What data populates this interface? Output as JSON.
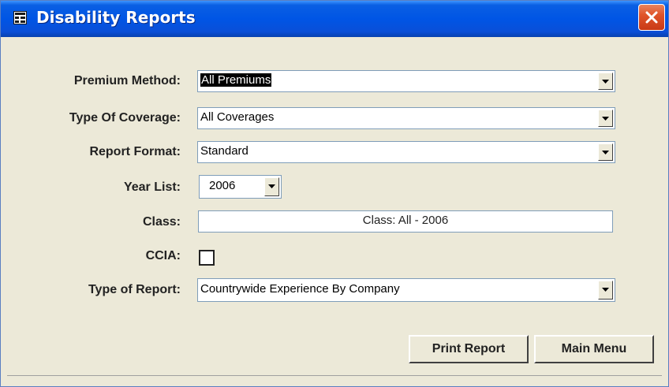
{
  "window": {
    "title": "Disability Reports",
    "icon": "form-icon",
    "close_icon": "close-icon"
  },
  "form": {
    "premium_method": {
      "label": "Premium Method:",
      "value": "All Premiums"
    },
    "type_of_coverage": {
      "label": "Type Of Coverage:",
      "value": "All Coverages"
    },
    "report_format": {
      "label": "Report Format:",
      "value": "Standard"
    },
    "year_list": {
      "label": "Year List:",
      "value": "2006"
    },
    "class": {
      "label": "Class:",
      "value": "Class: All - 2006"
    },
    "ccia": {
      "label": "CCIA:",
      "checked": false
    },
    "type_of_report": {
      "label": "Type of Report:",
      "value": "Countrywide Experience By Company"
    }
  },
  "buttons": {
    "print_report": "Print Report",
    "main_menu": "Main Menu"
  }
}
